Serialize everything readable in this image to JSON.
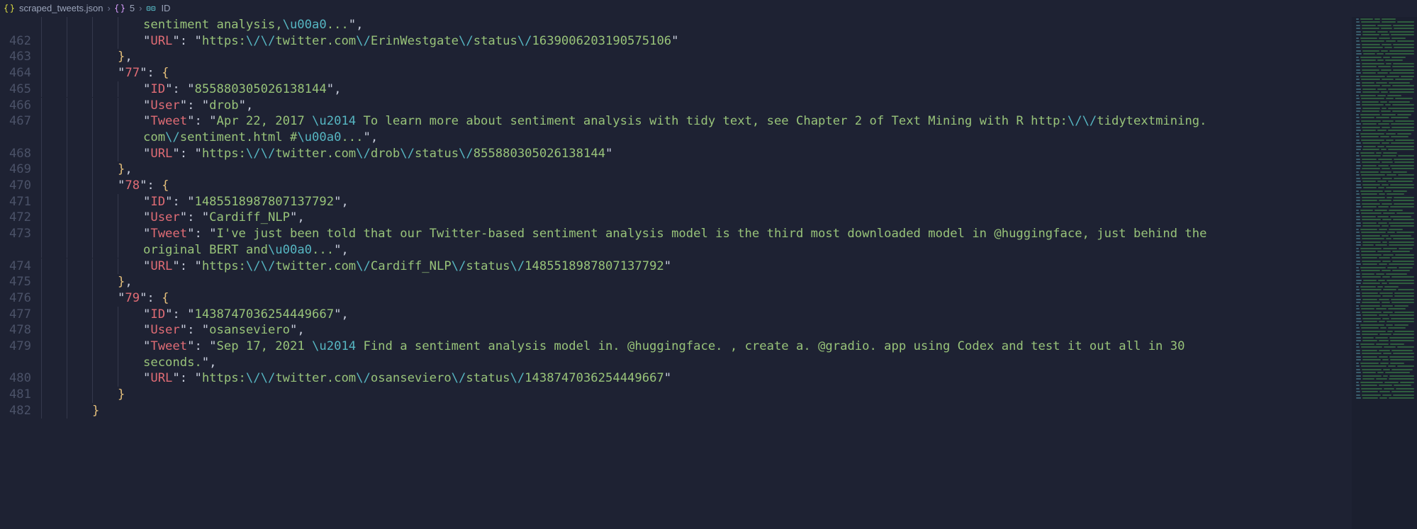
{
  "breadcrumb": {
    "file": "scraped_tweets.json",
    "path1": "5",
    "path2": "ID"
  },
  "lines": [
    {
      "n": "",
      "indent": 4,
      "tokens": [
        {
          "c": "s",
          "t": "sentiment analysis,"
        },
        {
          "c": "e",
          "t": "\\u00a0"
        },
        {
          "c": "s",
          "t": "..."
        },
        {
          "c": "p",
          "t": "\","
        },
        {
          "c": "",
          "t": ""
        }
      ]
    },
    {
      "n": "462",
      "indent": 4,
      "tokens": [
        {
          "c": "p",
          "t": "\""
        },
        {
          "c": "k",
          "t": "URL"
        },
        {
          "c": "p",
          "t": "\": \""
        },
        {
          "c": "s",
          "t": "https:"
        },
        {
          "c": "e",
          "t": "\\/\\/"
        },
        {
          "c": "s",
          "t": "twitter.com"
        },
        {
          "c": "e",
          "t": "\\/"
        },
        {
          "c": "s",
          "t": "ErinWestgate"
        },
        {
          "c": "e",
          "t": "\\/"
        },
        {
          "c": "s",
          "t": "status"
        },
        {
          "c": "e",
          "t": "\\/"
        },
        {
          "c": "s",
          "t": "1639006203190575106"
        },
        {
          "c": "p",
          "t": "\""
        }
      ]
    },
    {
      "n": "463",
      "indent": 3,
      "tokens": [
        {
          "c": "b",
          "t": "}"
        },
        {
          "c": "p",
          "t": ","
        }
      ]
    },
    {
      "n": "464",
      "indent": 3,
      "tokens": [
        {
          "c": "p",
          "t": "\""
        },
        {
          "c": "k",
          "t": "77"
        },
        {
          "c": "p",
          "t": "\": "
        },
        {
          "c": "b",
          "t": "{"
        }
      ]
    },
    {
      "n": "465",
      "indent": 4,
      "tokens": [
        {
          "c": "p",
          "t": "\""
        },
        {
          "c": "k",
          "t": "ID"
        },
        {
          "c": "p",
          "t": "\": \""
        },
        {
          "c": "s",
          "t": "855880305026138144"
        },
        {
          "c": "p",
          "t": "\","
        }
      ]
    },
    {
      "n": "466",
      "indent": 4,
      "tokens": [
        {
          "c": "p",
          "t": "\""
        },
        {
          "c": "k",
          "t": "User"
        },
        {
          "c": "p",
          "t": "\": \""
        },
        {
          "c": "s",
          "t": "drob"
        },
        {
          "c": "p",
          "t": "\","
        }
      ]
    },
    {
      "n": "467",
      "indent": 4,
      "tokens": [
        {
          "c": "p",
          "t": "\""
        },
        {
          "c": "k",
          "t": "Tweet"
        },
        {
          "c": "p",
          "t": "\": \""
        },
        {
          "c": "s",
          "t": "Apr 22, 2017 "
        },
        {
          "c": "e",
          "t": "\\u2014"
        },
        {
          "c": "s",
          "t": " To learn more about sentiment analysis with tidy text, see Chapter 2 of Text Mining with R http:"
        },
        {
          "c": "e",
          "t": "\\/\\/"
        },
        {
          "c": "s",
          "t": "tidytextmining."
        }
      ]
    },
    {
      "n": "",
      "indent": 4,
      "tokens": [
        {
          "c": "s",
          "t": "com"
        },
        {
          "c": "e",
          "t": "\\/"
        },
        {
          "c": "s",
          "t": "sentiment.html #"
        },
        {
          "c": "e",
          "t": "\\u00a0"
        },
        {
          "c": "s",
          "t": "..."
        },
        {
          "c": "p",
          "t": "\","
        }
      ]
    },
    {
      "n": "468",
      "indent": 4,
      "tokens": [
        {
          "c": "p",
          "t": "\""
        },
        {
          "c": "k",
          "t": "URL"
        },
        {
          "c": "p",
          "t": "\": \""
        },
        {
          "c": "s",
          "t": "https:"
        },
        {
          "c": "e",
          "t": "\\/\\/"
        },
        {
          "c": "s",
          "t": "twitter.com"
        },
        {
          "c": "e",
          "t": "\\/"
        },
        {
          "c": "s",
          "t": "drob"
        },
        {
          "c": "e",
          "t": "\\/"
        },
        {
          "c": "s",
          "t": "status"
        },
        {
          "c": "e",
          "t": "\\/"
        },
        {
          "c": "s",
          "t": "855880305026138144"
        },
        {
          "c": "p",
          "t": "\""
        }
      ]
    },
    {
      "n": "469",
      "indent": 3,
      "tokens": [
        {
          "c": "b",
          "t": "}"
        },
        {
          "c": "p",
          "t": ","
        }
      ]
    },
    {
      "n": "470",
      "indent": 3,
      "tokens": [
        {
          "c": "p",
          "t": "\""
        },
        {
          "c": "k",
          "t": "78"
        },
        {
          "c": "p",
          "t": "\": "
        },
        {
          "c": "b",
          "t": "{"
        }
      ]
    },
    {
      "n": "471",
      "indent": 4,
      "tokens": [
        {
          "c": "p",
          "t": "\""
        },
        {
          "c": "k",
          "t": "ID"
        },
        {
          "c": "p",
          "t": "\": \""
        },
        {
          "c": "s",
          "t": "1485518987807137792"
        },
        {
          "c": "p",
          "t": "\","
        }
      ]
    },
    {
      "n": "472",
      "indent": 4,
      "tokens": [
        {
          "c": "p",
          "t": "\""
        },
        {
          "c": "k",
          "t": "User"
        },
        {
          "c": "p",
          "t": "\": \""
        },
        {
          "c": "s",
          "t": "Cardiff_NLP"
        },
        {
          "c": "p",
          "t": "\","
        }
      ]
    },
    {
      "n": "473",
      "indent": 4,
      "tokens": [
        {
          "c": "p",
          "t": "\""
        },
        {
          "c": "k",
          "t": "Tweet"
        },
        {
          "c": "p",
          "t": "\": \""
        },
        {
          "c": "s",
          "t": "I've just been told that our Twitter-based sentiment analysis model is the third most downloaded model in @huggingface, just behind the"
        }
      ]
    },
    {
      "n": "",
      "indent": 4,
      "tokens": [
        {
          "c": "s",
          "t": "original BERT and"
        },
        {
          "c": "e",
          "t": "\\u00a0"
        },
        {
          "c": "s",
          "t": "..."
        },
        {
          "c": "p",
          "t": "\","
        }
      ]
    },
    {
      "n": "474",
      "indent": 4,
      "tokens": [
        {
          "c": "p",
          "t": "\""
        },
        {
          "c": "k",
          "t": "URL"
        },
        {
          "c": "p",
          "t": "\": \""
        },
        {
          "c": "s",
          "t": "https:"
        },
        {
          "c": "e",
          "t": "\\/\\/"
        },
        {
          "c": "s",
          "t": "twitter.com"
        },
        {
          "c": "e",
          "t": "\\/"
        },
        {
          "c": "s",
          "t": "Cardiff_NLP"
        },
        {
          "c": "e",
          "t": "\\/"
        },
        {
          "c": "s",
          "t": "status"
        },
        {
          "c": "e",
          "t": "\\/"
        },
        {
          "c": "s",
          "t": "1485518987807137792"
        },
        {
          "c": "p",
          "t": "\""
        }
      ]
    },
    {
      "n": "475",
      "indent": 3,
      "tokens": [
        {
          "c": "b",
          "t": "}"
        },
        {
          "c": "p",
          "t": ","
        }
      ]
    },
    {
      "n": "476",
      "indent": 3,
      "tokens": [
        {
          "c": "p",
          "t": "\""
        },
        {
          "c": "k",
          "t": "79"
        },
        {
          "c": "p",
          "t": "\": "
        },
        {
          "c": "b",
          "t": "{"
        }
      ]
    },
    {
      "n": "477",
      "indent": 4,
      "tokens": [
        {
          "c": "p",
          "t": "\""
        },
        {
          "c": "k",
          "t": "ID"
        },
        {
          "c": "p",
          "t": "\": \""
        },
        {
          "c": "s",
          "t": "1438747036254449667"
        },
        {
          "c": "p",
          "t": "\","
        }
      ]
    },
    {
      "n": "478",
      "indent": 4,
      "tokens": [
        {
          "c": "p",
          "t": "\""
        },
        {
          "c": "k",
          "t": "User"
        },
        {
          "c": "p",
          "t": "\": \""
        },
        {
          "c": "s",
          "t": "osanseviero"
        },
        {
          "c": "p",
          "t": "\","
        }
      ]
    },
    {
      "n": "479",
      "indent": 4,
      "tokens": [
        {
          "c": "p",
          "t": "\""
        },
        {
          "c": "k",
          "t": "Tweet"
        },
        {
          "c": "p",
          "t": "\": \""
        },
        {
          "c": "s",
          "t": "Sep 17, 2021 "
        },
        {
          "c": "e",
          "t": "\\u2014"
        },
        {
          "c": "s",
          "t": " Find a sentiment analysis model in. @huggingface. , create a. @gradio. app using Codex and test it out all in 30"
        }
      ]
    },
    {
      "n": "",
      "indent": 4,
      "tokens": [
        {
          "c": "s",
          "t": "seconds."
        },
        {
          "c": "p",
          "t": "\","
        }
      ]
    },
    {
      "n": "480",
      "indent": 4,
      "tokens": [
        {
          "c": "p",
          "t": "\""
        },
        {
          "c": "k",
          "t": "URL"
        },
        {
          "c": "p",
          "t": "\": \""
        },
        {
          "c": "s",
          "t": "https:"
        },
        {
          "c": "e",
          "t": "\\/\\/"
        },
        {
          "c": "s",
          "t": "twitter.com"
        },
        {
          "c": "e",
          "t": "\\/"
        },
        {
          "c": "s",
          "t": "osanseviero"
        },
        {
          "c": "e",
          "t": "\\/"
        },
        {
          "c": "s",
          "t": "status"
        },
        {
          "c": "e",
          "t": "\\/"
        },
        {
          "c": "s",
          "t": "1438747036254449667"
        },
        {
          "c": "p",
          "t": "\""
        }
      ]
    },
    {
      "n": "481",
      "indent": 3,
      "tokens": [
        {
          "c": "b",
          "t": "}"
        }
      ]
    },
    {
      "n": "482",
      "indent": 2,
      "tokens": [
        {
          "c": "b",
          "t": "}"
        }
      ]
    }
  ],
  "minimap_rows": 120
}
